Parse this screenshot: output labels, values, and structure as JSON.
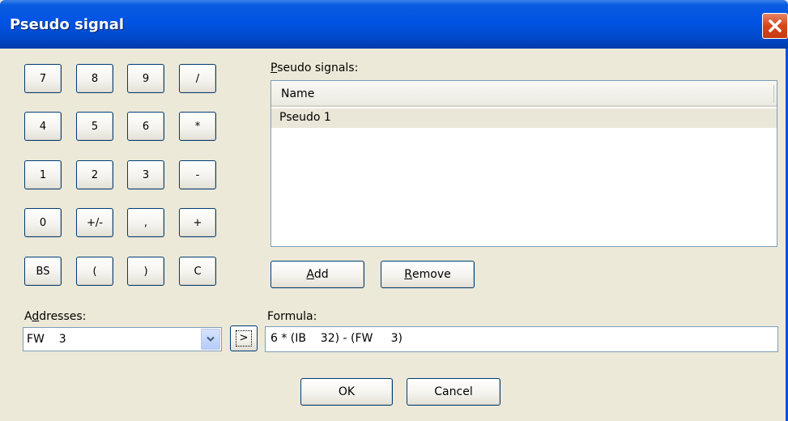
{
  "window": {
    "title": "Pseudo signal",
    "close_icon": "close-icon"
  },
  "keypad": {
    "rows": [
      [
        "7",
        "8",
        "9",
        "/"
      ],
      [
        "4",
        "5",
        "6",
        "*"
      ],
      [
        "1",
        "2",
        "3",
        "-"
      ],
      [
        "0",
        "+/-",
        ",",
        "+"
      ],
      [
        "BS",
        "(",
        ")",
        "C"
      ]
    ]
  },
  "signals": {
    "label_mnemonic": "P",
    "label_rest": "seudo signals:",
    "column_name": "Name",
    "items": [
      "Pseudo 1"
    ]
  },
  "buttons": {
    "add_mnemonic": "A",
    "add_rest": "dd",
    "remove_mnemonic": "R",
    "remove_rest": "emove",
    "ok": "OK",
    "cancel": "Cancel",
    "insert": ">"
  },
  "addresses": {
    "label_first": "A",
    "label_mnemonic": "d",
    "label_rest": "dresses:",
    "value": "FW    3"
  },
  "formula": {
    "label": "Formula:",
    "value": "6 * (IB    32) - (FW     3)"
  },
  "colors": {
    "titlebar": "#0054e3",
    "dialog_bg": "#ece9d8",
    "close_button": "#d8441a",
    "list_selection": "#eae7d8"
  }
}
